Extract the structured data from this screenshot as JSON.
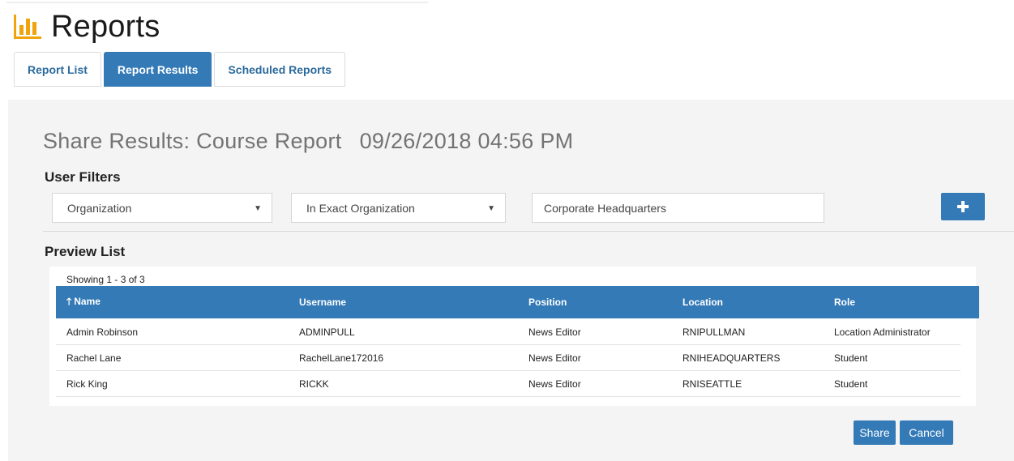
{
  "header": {
    "title": "Reports",
    "icon": "bar-chart-icon",
    "icon_color": "#f0a30a"
  },
  "tabs": [
    {
      "label": "Report List",
      "active": false
    },
    {
      "label": "Report Results",
      "active": true
    },
    {
      "label": "Scheduled Reports",
      "active": false
    }
  ],
  "share": {
    "title": "Share Results: Course Report",
    "datetime": "09/26/2018 04:56 PM"
  },
  "filters": {
    "label": "User Filters",
    "field_select": "Organization",
    "operator_select": "In Exact Organization",
    "value": "Corporate Headquarters",
    "add_icon": "plus-icon"
  },
  "preview": {
    "label": "Preview List",
    "showing": "Showing 1 - 3 of 3",
    "columns": [
      "Name",
      "Username",
      "Position",
      "Location",
      "Role"
    ],
    "sort_icon": "arrow-up-icon",
    "rows": [
      [
        "Admin Robinson",
        "ADMINPULL",
        "News Editor",
        "RNIPULLMAN",
        "Location Administrator"
      ],
      [
        "Rachel Lane",
        "RachelLane172016",
        "News Editor",
        "RNIHEADQUARTERS",
        "Student"
      ],
      [
        "Rick King",
        "RICKK",
        "News Editor",
        "RNISEATTLE",
        "Student"
      ]
    ]
  },
  "actions": {
    "share_label": "Share",
    "cancel_label": "Cancel"
  },
  "colors": {
    "primary": "#337ab7",
    "panel": "#f4f4f4"
  }
}
